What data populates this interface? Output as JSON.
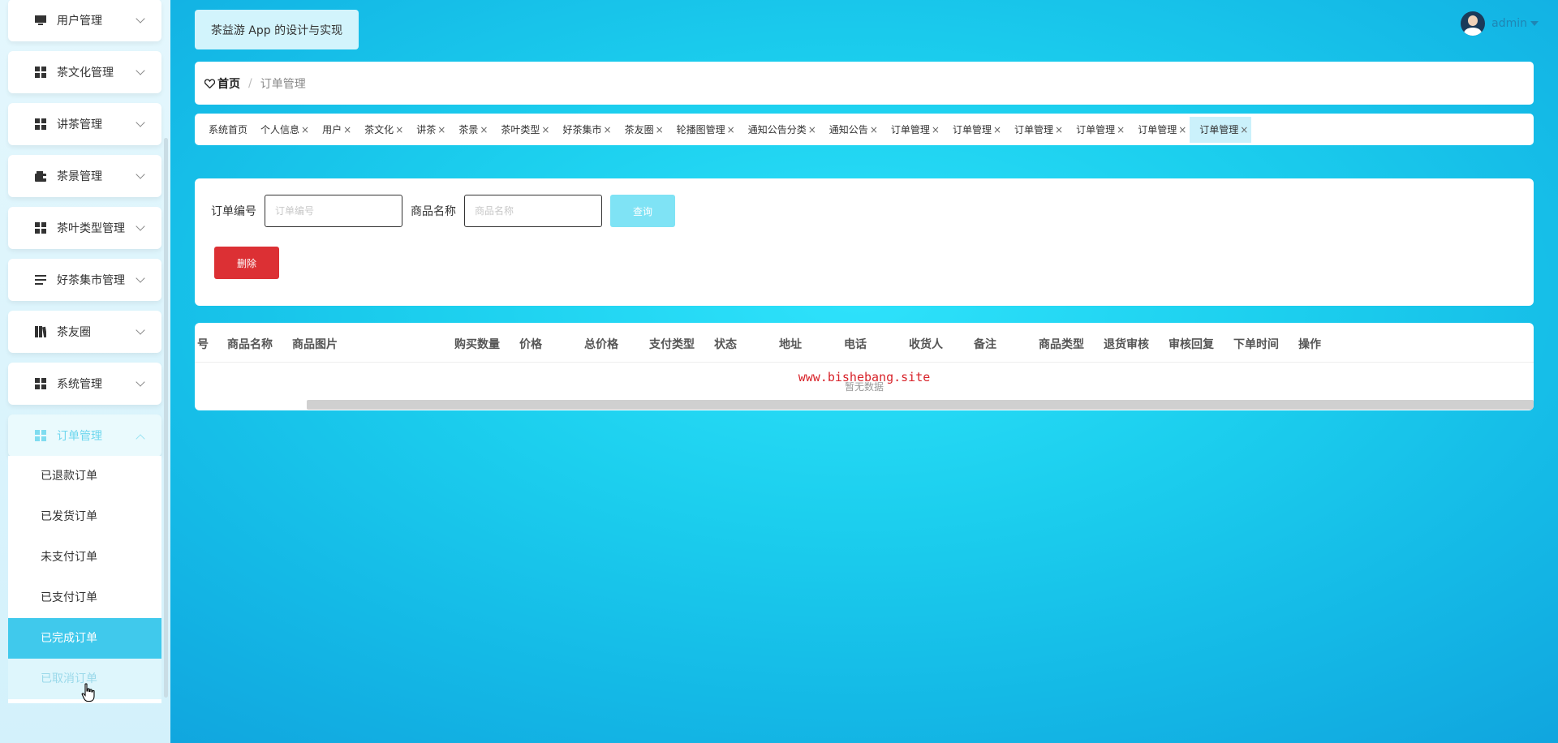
{
  "app": {
    "title": "茶益游 App 的设计与实现",
    "username": "admin"
  },
  "sidebar": {
    "items": [
      {
        "label": "用户管理",
        "icon": "monitor-icon"
      },
      {
        "label": "茶文化管理",
        "icon": "grid-icon"
      },
      {
        "label": "讲茶管理",
        "icon": "grid-icon"
      },
      {
        "label": "茶景管理",
        "icon": "wallet-icon"
      },
      {
        "label": "茶叶类型管理",
        "icon": "grid-icon"
      },
      {
        "label": "好茶集市管理",
        "icon": "list-icon"
      },
      {
        "label": "茶友圈",
        "icon": "book-icon"
      },
      {
        "label": "系统管理",
        "icon": "grid-icon"
      },
      {
        "label": "订单管理",
        "icon": "grid-icon"
      }
    ],
    "submenu": [
      "已退款订单",
      "已发货订单",
      "未支付订单",
      "已支付订单",
      "已完成订单",
      "已取消订单"
    ]
  },
  "breadcrumb": {
    "home": "首页",
    "separator": "/",
    "current": "订单管理"
  },
  "tabs": [
    "系统首页",
    "个人信息",
    "用户",
    "茶文化",
    "讲茶",
    "茶景",
    "茶叶类型",
    "好茶集市",
    "茶友圈",
    "轮播图管理",
    "通知公告分类",
    "通知公告",
    "订单管理",
    "订单管理",
    "订单管理",
    "订单管理",
    "订单管理",
    "订单管理"
  ],
  "search": {
    "order_no_label": "订单编号",
    "order_no_placeholder": "订单编号",
    "order_no_value": "",
    "product_label": "商品名称",
    "product_placeholder": "商品名称",
    "product_value": "",
    "query_label": "查询",
    "delete_label": "删除"
  },
  "table": {
    "columns": [
      "号",
      "商品名称",
      "商品图片",
      "购买数量",
      "价格",
      "总价格",
      "支付类型",
      "状态",
      "地址",
      "电话",
      "收货人",
      "备注",
      "商品类型",
      "退货审核",
      "审核回复",
      "下单时间",
      "操作"
    ],
    "empty_text": "暂无数据",
    "watermark": "www.bishebang.site"
  },
  "colors": {
    "accent": "#40c9ec",
    "danger": "#dc3034",
    "query": "#7fe3f5"
  }
}
